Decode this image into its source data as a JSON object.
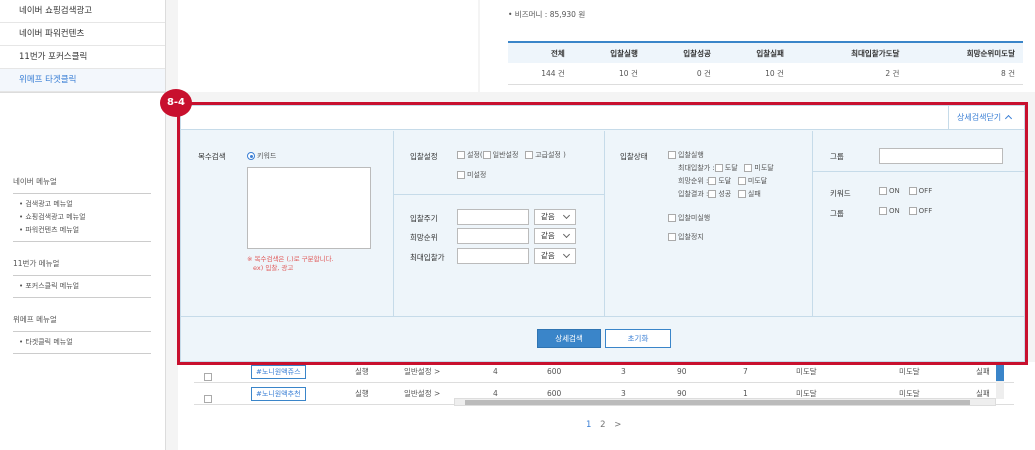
{
  "sidebar": {
    "top_items": [
      {
        "label": "네이버 쇼핑검색광고",
        "active": false
      },
      {
        "label": "네이버 파워컨텐츠",
        "active": false
      },
      {
        "label": "11번가 포커스클릭",
        "active": false
      },
      {
        "label": "위메프 타겟클릭",
        "active": true
      }
    ],
    "groups": [
      {
        "title": "네이버 메뉴얼",
        "items": [
          "• 검색광고 메뉴얼",
          "• 쇼핑검색광고 메뉴얼",
          "• 파워컨텐츠 메뉴얼"
        ]
      },
      {
        "title": "11번가 메뉴얼",
        "items": [
          "• 포커스클릭 메뉴얼"
        ]
      },
      {
        "title": "위메프 메뉴얼",
        "items": [
          "• 타겟클릭 메뉴얼"
        ]
      }
    ]
  },
  "summary": {
    "money": "• 비즈머니 : 85,930 원",
    "headers": [
      "전체",
      "입찰실행",
      "입찰성공",
      "입찰실패",
      "최대입찰가도달",
      "희망순위미도달"
    ],
    "values": [
      "144 건",
      "10 건",
      "0 건",
      "10 건",
      "2 건",
      "8 건"
    ]
  },
  "badge": "8-4",
  "panel": {
    "collapse_label": "상세검색닫기",
    "multi_search": {
      "label": "복수검색",
      "radio_label": "키워드",
      "note_line1": "※ 복수검색은 (,)로 구분합니다.",
      "note_line2": "ex) 입찰, 광고"
    },
    "bid_setting": {
      "label": "입찰설정",
      "options": [
        "설정(",
        "일반설정",
        "고급설정 )"
      ],
      "unset": "미설정"
    },
    "bid_fields": [
      {
        "label": "입찰주기",
        "select": "같음"
      },
      {
        "label": "희망순위",
        "select": "같음"
      },
      {
        "label": "최대입찰가",
        "select": "같음"
      }
    ],
    "bid_status": {
      "label": "입찰상태",
      "exec": "입찰실행",
      "max_bid_label": "최대입찰가 :",
      "rank_label": "희망순위 :",
      "result_label": "입찰결과 :",
      "reached": "도달",
      "not_reached": "미도달",
      "success": "성공",
      "fail": "실패",
      "not_exec": "입찰미실행",
      "stopped": "입찰정지"
    },
    "group": {
      "label": "그룹",
      "keyword_label": "키워드",
      "group_label": "그룹",
      "on": "ON",
      "off": "OFF"
    },
    "search_button": "상세검색",
    "reset_button": "초기화"
  },
  "results": {
    "rows": [
      {
        "keyword": "#노니원액쥬스",
        "action": "실행",
        "setting": "일반설정 >",
        "cycle": "4",
        "max_bid": "600",
        "rank": "3",
        "cur": "90",
        "bid": "7",
        "s1": "미도달",
        "s2": "미도달",
        "s3": "실패"
      },
      {
        "keyword": "#노니원액추천",
        "action": "실행",
        "setting": "일반설정 >",
        "cycle": "4",
        "max_bid": "600",
        "rank": "3",
        "cur": "90",
        "bid": "1",
        "s1": "미도달",
        "s2": "미도달",
        "s3": "실패"
      }
    ],
    "pages": [
      "1",
      "2",
      ">"
    ]
  }
}
